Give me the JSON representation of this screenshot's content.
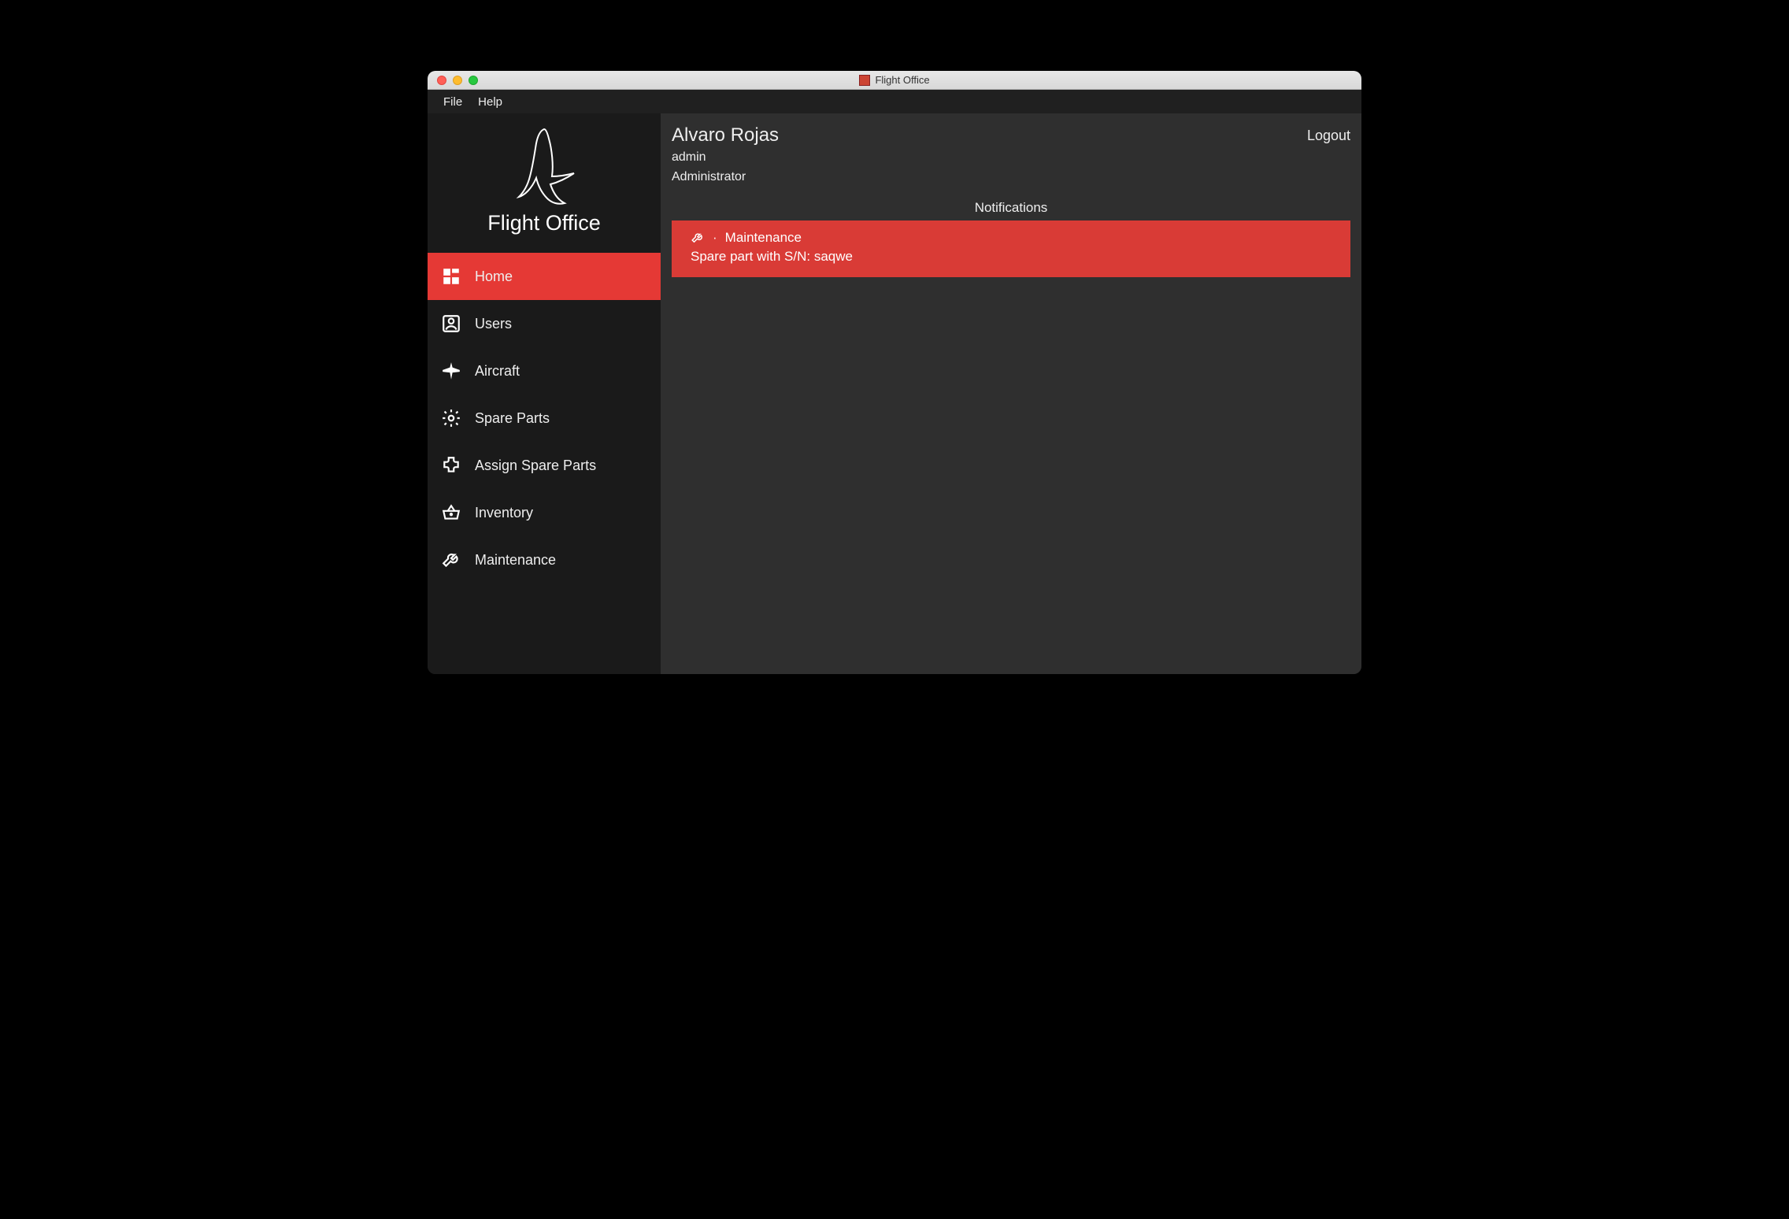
{
  "window": {
    "title": "Flight Office"
  },
  "menubar": {
    "items": [
      "File",
      "Help"
    ]
  },
  "sidebar": {
    "brand": "Flight Office",
    "items": [
      {
        "label": "Home",
        "icon": "dashboard-icon",
        "active": true
      },
      {
        "label": "Users",
        "icon": "user-icon"
      },
      {
        "label": "Aircraft",
        "icon": "airplane-icon"
      },
      {
        "label": "Spare Parts",
        "icon": "gear-icon"
      },
      {
        "label": "Assign Spare Parts",
        "icon": "extension-icon"
      },
      {
        "label": "Inventory",
        "icon": "basket-icon"
      },
      {
        "label": "Maintenance",
        "icon": "wrench-icon"
      }
    ]
  },
  "header": {
    "user_name": "Alvaro Rojas",
    "user_login": "admin",
    "user_role": "Administrator",
    "logout_label": "Logout"
  },
  "notifications": {
    "title": "Notifications",
    "items": [
      {
        "category": "Maintenance",
        "separator": "·",
        "message": "Spare part with S/N: saqwe"
      }
    ]
  },
  "colors": {
    "accent": "#e53935",
    "notif_bg": "#d93b36",
    "sidebar_bg": "#1a1a1a",
    "main_bg": "#2f2f2f"
  }
}
